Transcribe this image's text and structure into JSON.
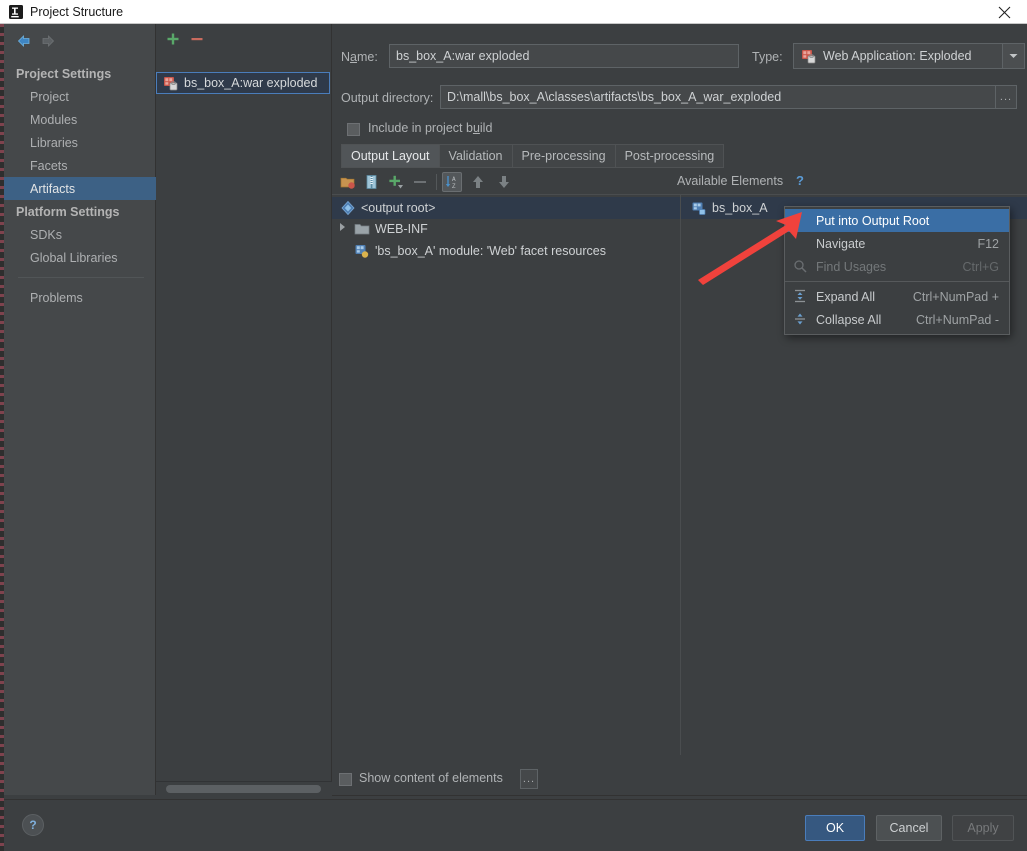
{
  "window": {
    "title": "Project Structure",
    "logo_icon": "intellij-idea-logo-icon",
    "close_icon": "close-icon"
  },
  "sidebar": {
    "nav": {
      "back_icon": "arrow-left-icon",
      "forward_icon": "arrow-right-icon"
    },
    "groups": [
      {
        "label": "Project Settings",
        "items": [
          {
            "label": "Project",
            "selected": false
          },
          {
            "label": "Modules",
            "selected": false
          },
          {
            "label": "Libraries",
            "selected": false
          },
          {
            "label": "Facets",
            "selected": false
          },
          {
            "label": "Artifacts",
            "selected": true
          }
        ]
      },
      {
        "label": "Platform Settings",
        "items": [
          {
            "label": "SDKs",
            "selected": false
          },
          {
            "label": "Global Libraries",
            "selected": false
          }
        ]
      }
    ],
    "extra_items": [
      {
        "label": "Problems",
        "selected": false
      }
    ],
    "selection_color": "#3d6185"
  },
  "artifacts_panel": {
    "add_icon": "plus-icon",
    "remove_icon": "minus-icon",
    "items": [
      {
        "label": "bs_box_A:war exploded",
        "icon": "web-artifact-icon",
        "selected": true
      }
    ]
  },
  "editor": {
    "name_label": "Name:",
    "name_value": "bs_box_A:war exploded",
    "type_label": "Type:",
    "type_value": "Web Application: Exploded",
    "type_icon": "web-application-icon",
    "type_dropdown_icon": "chevron-down-icon",
    "output_dir_label": "Output directory:",
    "output_dir_value": "D:\\mall\\bs_box_A\\classes\\artifacts\\bs_box_A_war_exploded",
    "browse_label": "...",
    "include_in_build_label": "Include in project build",
    "include_in_build_checked": false,
    "tabs": [
      {
        "label": "Output Layout",
        "active": true
      },
      {
        "label": "Validation",
        "active": false
      },
      {
        "label": "Pre-processing",
        "active": false
      },
      {
        "label": "Post-processing",
        "active": false
      }
    ],
    "toolbar": [
      {
        "name": "create-directory-icon",
        "pressed": false
      },
      {
        "name": "create-archive-icon",
        "pressed": false
      },
      {
        "name": "add-copy-of-icon",
        "pressed": false
      },
      {
        "name": "remove-icon",
        "pressed": false
      },
      {
        "name": "sort-by-type-icon",
        "pressed": true
      },
      {
        "name": "move-up-icon",
        "pressed": false
      },
      {
        "name": "move-down-icon",
        "pressed": false
      }
    ],
    "available_elements_label": "Available Elements",
    "available_elements_help": "?",
    "output_tree": [
      {
        "label": "<output root>",
        "icon": "output-root-icon",
        "indent": 0,
        "selected": true,
        "expandable": false
      },
      {
        "label": "WEB-INF",
        "icon": "folder-icon",
        "indent": 0,
        "selected": false,
        "expandable": true
      },
      {
        "label": "'bs_box_A' module: 'Web' facet resources",
        "icon": "web-facet-icon",
        "indent": 1,
        "selected": false,
        "expandable": false
      }
    ],
    "available_tree": [
      {
        "label": "bs_box_A",
        "icon": "module-icon",
        "selected": true
      }
    ],
    "show_content_label": "Show content of elements",
    "show_content_checked": false,
    "show_content_browse": "..."
  },
  "context_menu": {
    "items": [
      {
        "label": "Put into Output Root",
        "accel": "",
        "icon": "",
        "highlight": true,
        "disabled": false
      },
      {
        "label": "Navigate",
        "accel": "F12",
        "icon": "",
        "highlight": false,
        "disabled": false
      },
      {
        "label": "Find Usages",
        "accel": "Ctrl+G",
        "icon": "find-usages-icon",
        "highlight": false,
        "disabled": true
      },
      {
        "label": "Expand All",
        "accel": "Ctrl+NumPad +",
        "icon": "expand-all-icon",
        "highlight": false,
        "disabled": false
      },
      {
        "label": "Collapse All",
        "accel": "Ctrl+NumPad -",
        "icon": "collapse-all-icon",
        "highlight": false,
        "disabled": false
      }
    ]
  },
  "annotation": {
    "arrow_color": "#f0423c",
    "arrow_name": "red-pointer-arrow"
  },
  "footer": {
    "help_label": "?",
    "ok_label": "OK",
    "cancel_label": "Cancel",
    "apply_label": "Apply"
  },
  "colors": {
    "background": "#3c3f41",
    "panel": "#45484a",
    "selection": "#3d6185",
    "tree_selection": "#2f3a4a",
    "menu_highlight": "#3a6ea5",
    "accent_blue": "#4a7dbb",
    "green": "#59a869",
    "red": "#f0423c"
  }
}
